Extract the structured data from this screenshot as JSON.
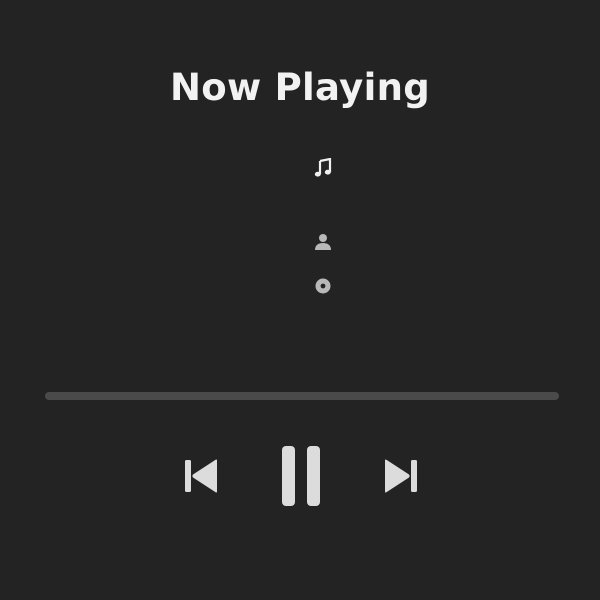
{
  "header": {
    "title": "Now Playing"
  },
  "track": {
    "title": "",
    "artist": "",
    "album": ""
  },
  "icons": {
    "track": "music-note-icon",
    "artist": "person-icon",
    "album": "disc-icon",
    "previous": "skip-previous-icon",
    "play_pause": "pause-icon",
    "next": "skip-next-icon"
  },
  "playback": {
    "state": "playing",
    "progress": 0
  },
  "colors": {
    "background": "#232323",
    "title_text": "#f2f2f2",
    "icon_primary": "#f0f0f0",
    "icon_secondary": "#b8b8b8",
    "control": "#dcdcdc",
    "progress_track": "#4a4a4a"
  }
}
